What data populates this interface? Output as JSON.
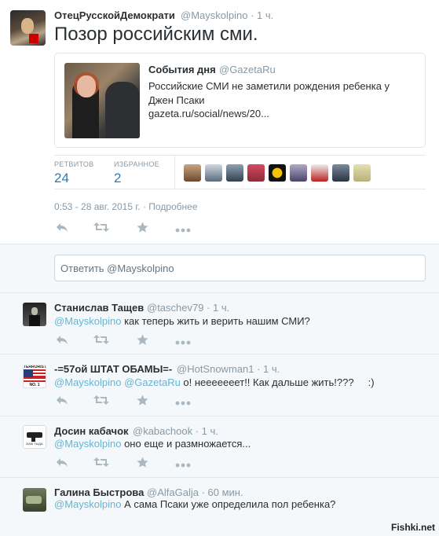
{
  "main_tweet": {
    "author_name": "ОтецРусскойДемократи",
    "author_handle": "@Mayskolpino",
    "time": "· 1 ч.",
    "text": "Позор российским сми.",
    "card": {
      "title": "События дня",
      "handle": "@GazetaRu",
      "description": "Российские СМИ не заметили рождения ребенка у Джен Псаки",
      "link": "gazeta.ru/social/news/20..."
    },
    "stats": {
      "retweets_label": "РЕТВИТОВ",
      "retweets_count": "24",
      "favorites_label": "ИЗБРАННОЕ",
      "favorites_count": "2"
    },
    "timestamp": "0:53 - 28 авг. 2015 г.",
    "details_link": "· Подробнее"
  },
  "reply_box": {
    "placeholder": "Ответить @Mayskolpino"
  },
  "replies": [
    {
      "name": "Станислав Тащев",
      "handle": "@taschev79",
      "time": "· 1 ч.",
      "text_parts": [
        "@Mayskolpino",
        " как теперь жить и верить нашим СМИ?"
      ]
    },
    {
      "name": "-=57ой ШТАТ ОБАМЫ=-",
      "handle": "@HotSnowman1",
      "time": "· 1 ч.",
      "text_parts": [
        "@Mayskolpino",
        " ",
        "@GazetaRu",
        " о! нееееееет!! Как дальше жить!???     :)"
      ]
    },
    {
      "name": "Досин кабачок",
      "handle": "@kabachook",
      "time": "· 1 ч.",
      "text_parts": [
        "@Mayskolpino",
        " оно еще и размножается..."
      ]
    },
    {
      "name": "Галина Быстрова",
      "handle": "@AlfaGalja",
      "time": "· 60 мин.",
      "text_parts": [
        "@Mayskolpino",
        " А сама Псаки уже определила пол ребенка?"
      ]
    }
  ],
  "watermark": "Fishki.net",
  "icons": [
    "reply-icon",
    "retweet-icon",
    "favorite-icon",
    "more-icon"
  ],
  "colors": {
    "link": "#66b5d2",
    "stat": "#2b7bb9",
    "muted": "#8899a6"
  }
}
